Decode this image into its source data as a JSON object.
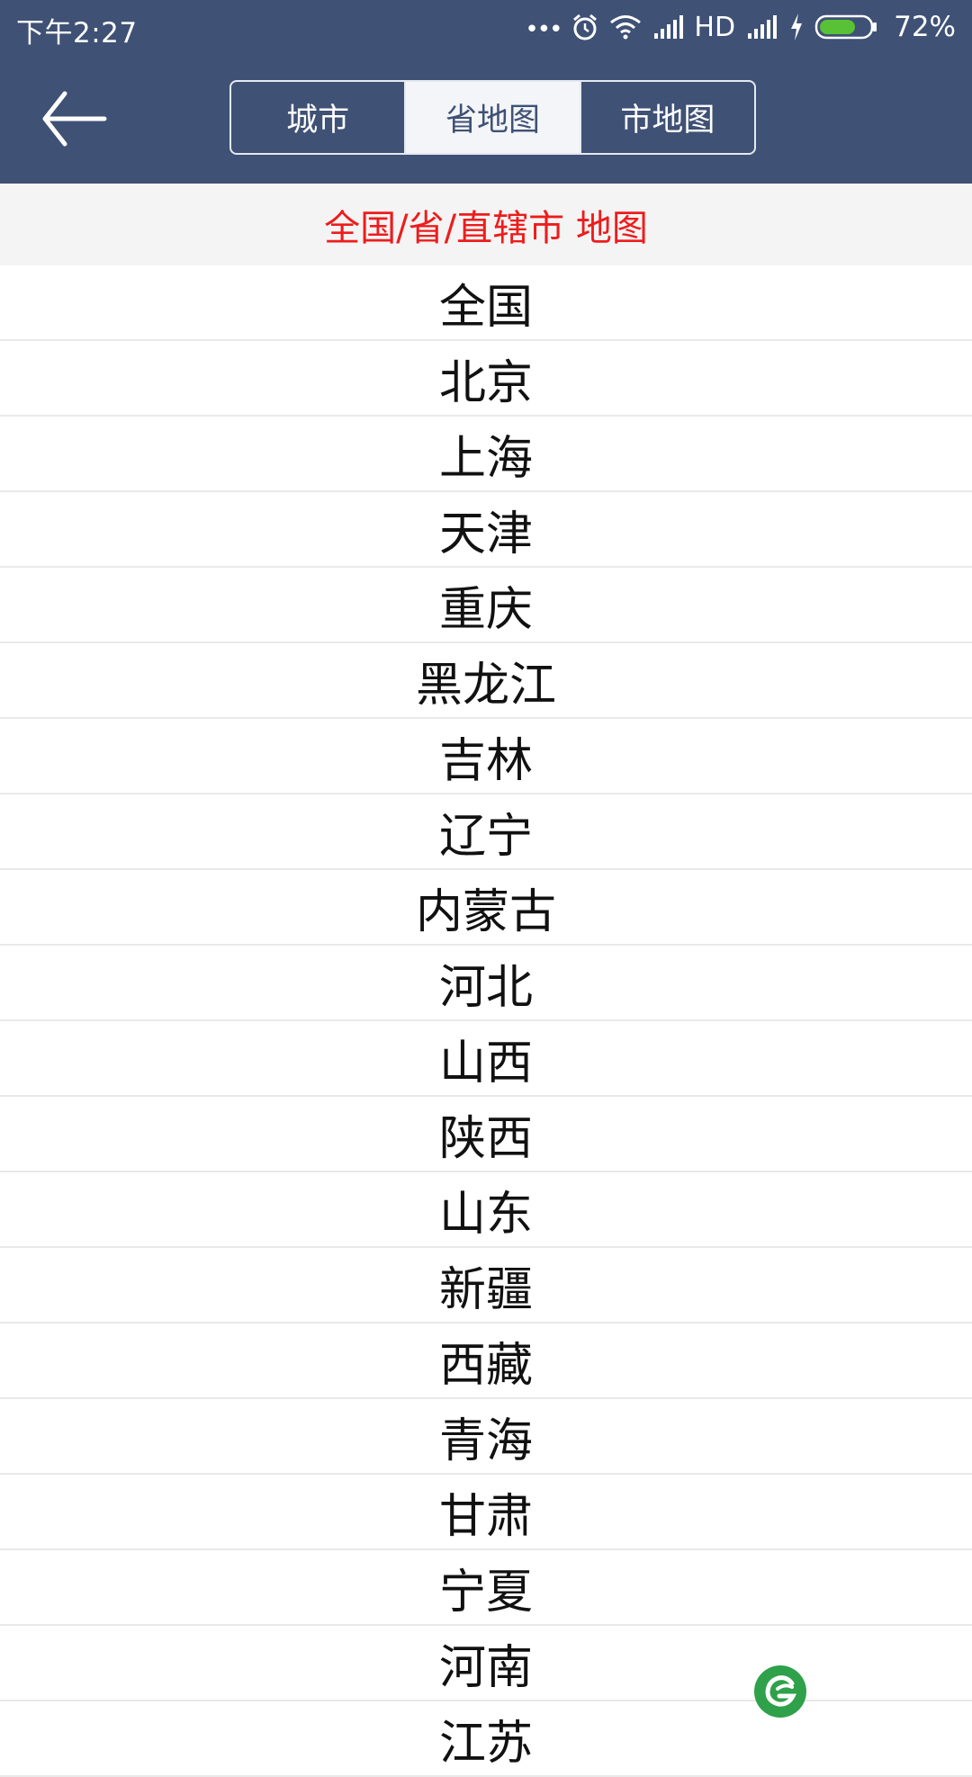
{
  "status_bar": {
    "time": "下午2:27",
    "dots": "•••",
    "network_type": "HD",
    "battery_percent": "72%",
    "battery_level": 0.72,
    "icons": [
      "more-dots-icon",
      "alarm-icon",
      "wifi-icon",
      "signal-icon",
      "signal-icon-2",
      "charging-icon",
      "battery-icon"
    ]
  },
  "header": {
    "back_icon": "back-arrow-icon",
    "tabs": [
      {
        "label": "城市",
        "active": false
      },
      {
        "label": "省地图",
        "active": true
      },
      {
        "label": "市地图",
        "active": false
      }
    ]
  },
  "subheader": {
    "title": "全国/省/直辖市 地图"
  },
  "regions": [
    "全国",
    "北京",
    "上海",
    "天津",
    "重庆",
    "黑龙江",
    "吉林",
    "辽宁",
    "内蒙古",
    "河北",
    "山西",
    "陕西",
    "山东",
    "新疆",
    "西藏",
    "青海",
    "甘肃",
    "宁夏",
    "河南",
    "江苏"
  ],
  "fab_icon": "app-logo-icon",
  "colors": {
    "header_bg": "#3f5175",
    "subheader_text": "#ee1c1c",
    "active_tab_bg": "#f4f5f8",
    "fab": "#2fa14a"
  }
}
